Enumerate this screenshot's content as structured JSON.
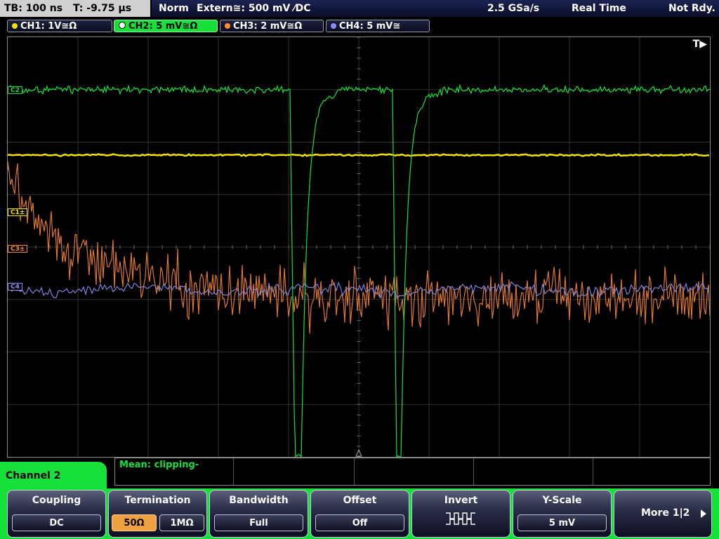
{
  "topbar": {
    "tb": "TB: 100 ns",
    "t": "T: -9.75 µs",
    "mode": "Norm",
    "trigger": "Extern≅: 500 mV ⁄DC",
    "rate": "2.5 GSa/s",
    "acq": "Real Time",
    "status": "Not Rdy."
  },
  "channels": [
    {
      "label": "CH1: 1V≅Ω",
      "color": "#f5e100",
      "active": false
    },
    {
      "label": "CH2: 5 mV≅Ω",
      "color": "#18e03a",
      "active": true
    },
    {
      "label": "CH3: 2 mV≅Ω",
      "color": "#ff8c2a",
      "active": false
    },
    {
      "label": "CH4: 5 mV≅",
      "color": "#8c8cf0",
      "active": false
    }
  ],
  "markers": {
    "c2": "C2",
    "c1": "C1±",
    "c3": "C3±",
    "c4": "C4",
    "trigger": "T▶"
  },
  "info": {
    "mean": "Mean: clipping-"
  },
  "menu": {
    "title": "Channel 2"
  },
  "softkeys": {
    "coupling": {
      "label": "Coupling",
      "value": "DC"
    },
    "termination": {
      "label": "Termination",
      "options": [
        "50Ω",
        "1MΩ"
      ],
      "selected": 0
    },
    "bandwidth": {
      "label": "Bandwidth",
      "value": "Full"
    },
    "offset": {
      "label": "Offset",
      "value": "Off"
    },
    "invert": {
      "label": "Invert",
      "icon": "inverted-square-wave-icon"
    },
    "yscale": {
      "label": "Y-Scale",
      "value": "5 mV"
    },
    "more": {
      "label": "More 1|2"
    }
  },
  "colors": {
    "ch1": "#f5e100",
    "ch2": "#18e03a",
    "ch3": "#e0782a",
    "ch4": "#8080e0",
    "grid": "#3a3a3a",
    "accent": "#18e03a"
  }
}
